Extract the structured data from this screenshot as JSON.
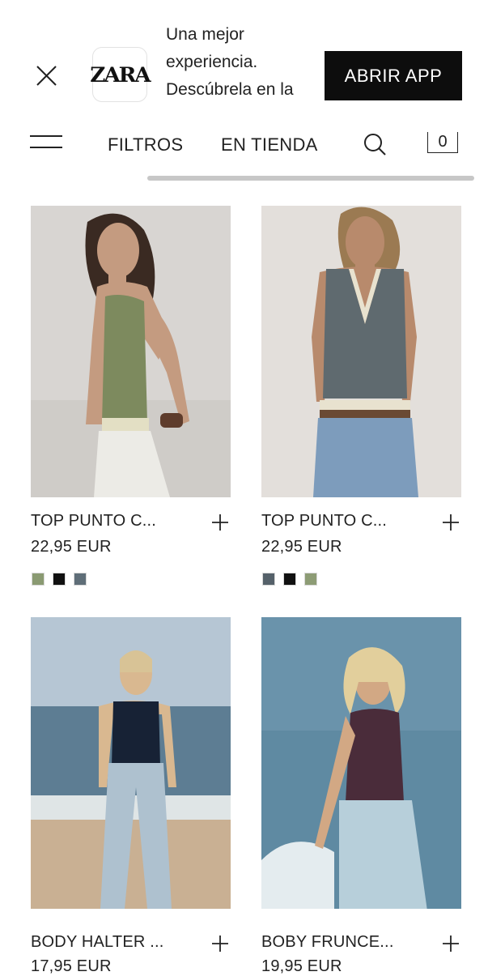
{
  "banner": {
    "logo_text": "ZARA",
    "lines": [
      "Una mejor",
      "experiencia.",
      "Descúbrela en la"
    ],
    "open_app_label": "ABRIR APP"
  },
  "nav": {
    "filters_label": "FILTROS",
    "store_label": "EN TIENDA",
    "cart_count": "0"
  },
  "products": [
    {
      "name": "TOP PUNTO C...",
      "price": "22,95 EUR",
      "swatches": [
        "#8a9a72",
        "#111111",
        "#5f6e78"
      ]
    },
    {
      "name": "TOP PUNTO C...",
      "price": "22,95 EUR",
      "swatches": [
        "#55616a",
        "#111111",
        "#8d9c75"
      ]
    },
    {
      "name": "BODY HALTER ...",
      "price": "17,95 EUR",
      "swatches": []
    },
    {
      "name": "BOBY FRUNCE...",
      "price": "19,95 EUR",
      "swatches": []
    }
  ]
}
